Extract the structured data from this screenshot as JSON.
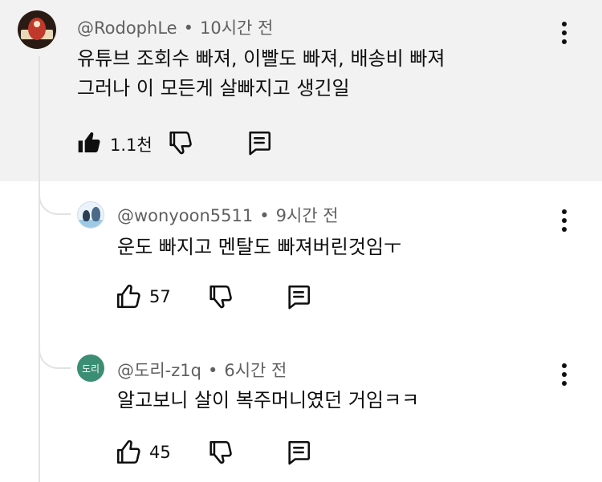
{
  "main_comment": {
    "author": "@RodophLe",
    "time": "10시간 전",
    "lines": [
      "유튜브 조회수 빠져, 이빨도 빠져, 배송비 빠져",
      "그러나 이 모든게 살빠지고 생긴일"
    ],
    "likes": "1.1천",
    "liked": true
  },
  "replies": [
    {
      "author": "@wonyoon5511",
      "time": "9시간 전",
      "text": "운도 빠지고 멘탈도 빠져버린것임ㅜ",
      "likes": "57"
    },
    {
      "author": "@도리-z1q",
      "avatar_label": "도리",
      "time": "6시간 전",
      "text": "알고보니 살이 복주머니였던 거임ㅋㅋ",
      "likes": "45"
    }
  ],
  "separator": "•",
  "icons": [
    "thumbs-up-icon",
    "thumbs-down-icon",
    "reply-icon",
    "more-vert-icon"
  ],
  "colors": {
    "main_bg": "#f2f2f2",
    "meta_text": "#606060",
    "avatar_green": "#3b8e73"
  }
}
